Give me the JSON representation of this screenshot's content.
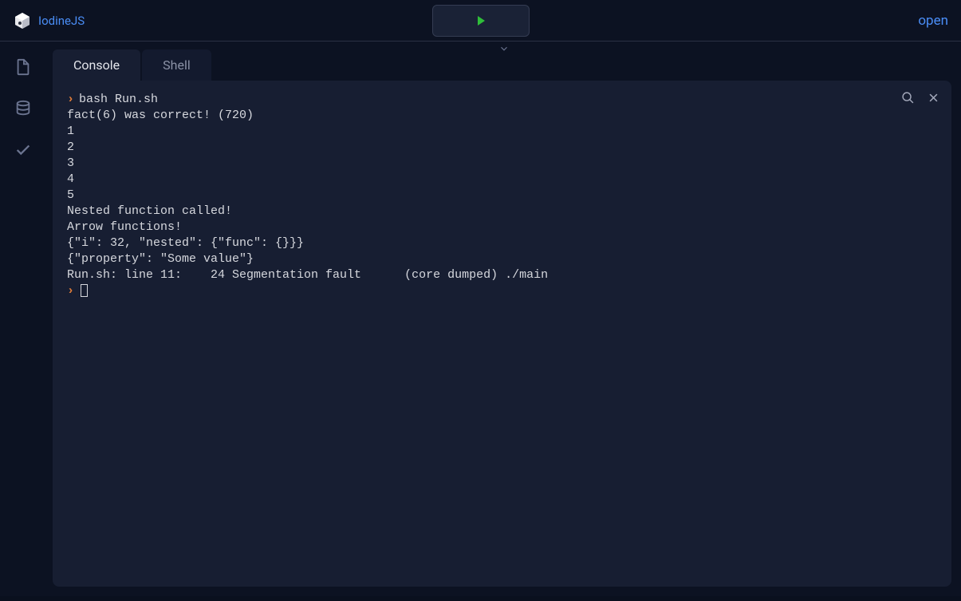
{
  "header": {
    "project_name": "IodineJS",
    "open_label": "open"
  },
  "tabs": {
    "console": "Console",
    "shell": "Shell"
  },
  "console": {
    "prompt": "",
    "command": "bash Run.sh",
    "lines": [
      "fact(6) was correct! (720)",
      "1",
      "2",
      "3",
      "4",
      "5",
      "Nested function called!",
      "Arrow functions!",
      "{\"i\": 32, \"nested\": {\"func\": {}}}",
      "{\"property\": \"Some value\"}",
      "Run.sh: line 11:    24 Segmentation fault      (core dumped) ./main"
    ]
  }
}
